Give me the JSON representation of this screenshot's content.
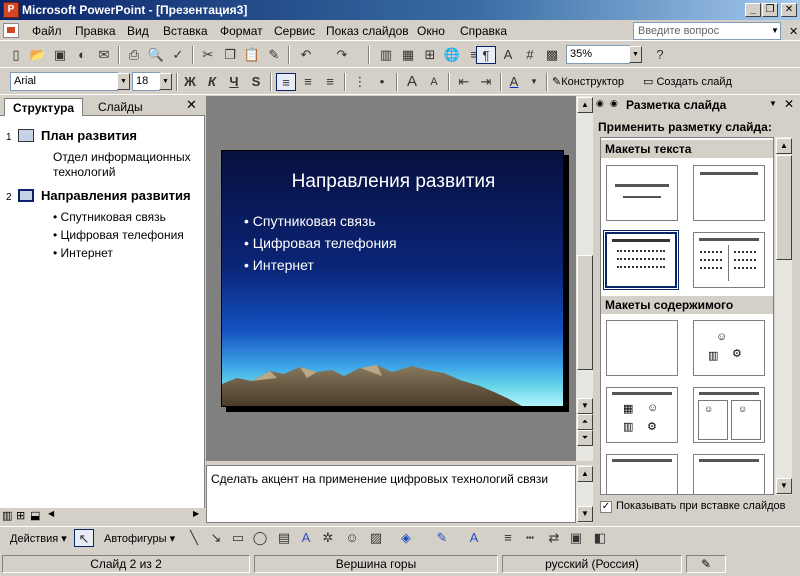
{
  "window": {
    "title": "Microsoft PowerPoint - [Презентация3]",
    "app_icon": "P"
  },
  "menu": {
    "items": [
      "Файл",
      "Правка",
      "Вид",
      "Вставка",
      "Формат",
      "Сервис",
      "Показ слайдов",
      "Окно",
      "Справка"
    ],
    "help_placeholder": "Введите вопрос"
  },
  "toolbar": {
    "zoom": "35%",
    "font": "Arial",
    "font_size": "18",
    "designer_label": "Конструктор",
    "new_slide_label": "Создать слайд",
    "bold": "Ж",
    "italic": "К",
    "underline": "Ч",
    "shadow": "S"
  },
  "outline": {
    "tab_structure": "Структура",
    "tab_slides": "Слайды",
    "slides": [
      {
        "num": "1",
        "title": "План развития",
        "lines": [
          "Отдел информационных",
          "технологий"
        ]
      },
      {
        "num": "2",
        "title": "Направления развития",
        "bullets": [
          "Спутниковая связь",
          "Цифровая телефония",
          "Интернет"
        ]
      }
    ]
  },
  "slide": {
    "title": "Направления развития",
    "bullets": [
      "Спутниковая связь",
      "Цифровая телефония",
      "Интернет"
    ]
  },
  "notes": {
    "text": "Сделать акцент на применение цифровых технологий связи"
  },
  "taskpane": {
    "title": "Разметка слайда",
    "apply_label": "Применить разметку слайда:",
    "section_text": "Макеты текста",
    "section_content": "Макеты содержимого",
    "show_on_insert": "Показывать при вставке слайдов"
  },
  "drawbar": {
    "actions": "Действия",
    "autoshapes": "Автофигуры"
  },
  "status": {
    "slide": "Слайд 2 из 2",
    "design": "Вершина горы",
    "language": "русский (Россия)"
  }
}
